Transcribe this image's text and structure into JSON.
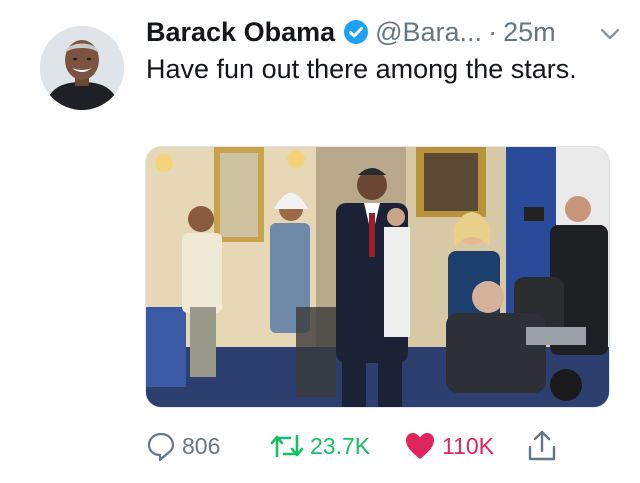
{
  "tweet": {
    "author_name": "Barack Obama",
    "handle": "@Bara...",
    "separator": "·",
    "time": "25m",
    "text": "Have fun out there among the stars."
  },
  "actions": {
    "replies": "806",
    "retweets": "23.7K",
    "likes": "110K"
  },
  "colors": {
    "verified": "#1da1f2",
    "retweet": "#17bf63",
    "like": "#e0245e",
    "muted": "#657786"
  },
  "icons": {
    "verified": "verified-badge-icon",
    "menu": "chevron-down-icon",
    "reply": "reply-icon",
    "retweet": "retweet-icon",
    "like": "heart-icon",
    "share": "share-icon"
  }
}
